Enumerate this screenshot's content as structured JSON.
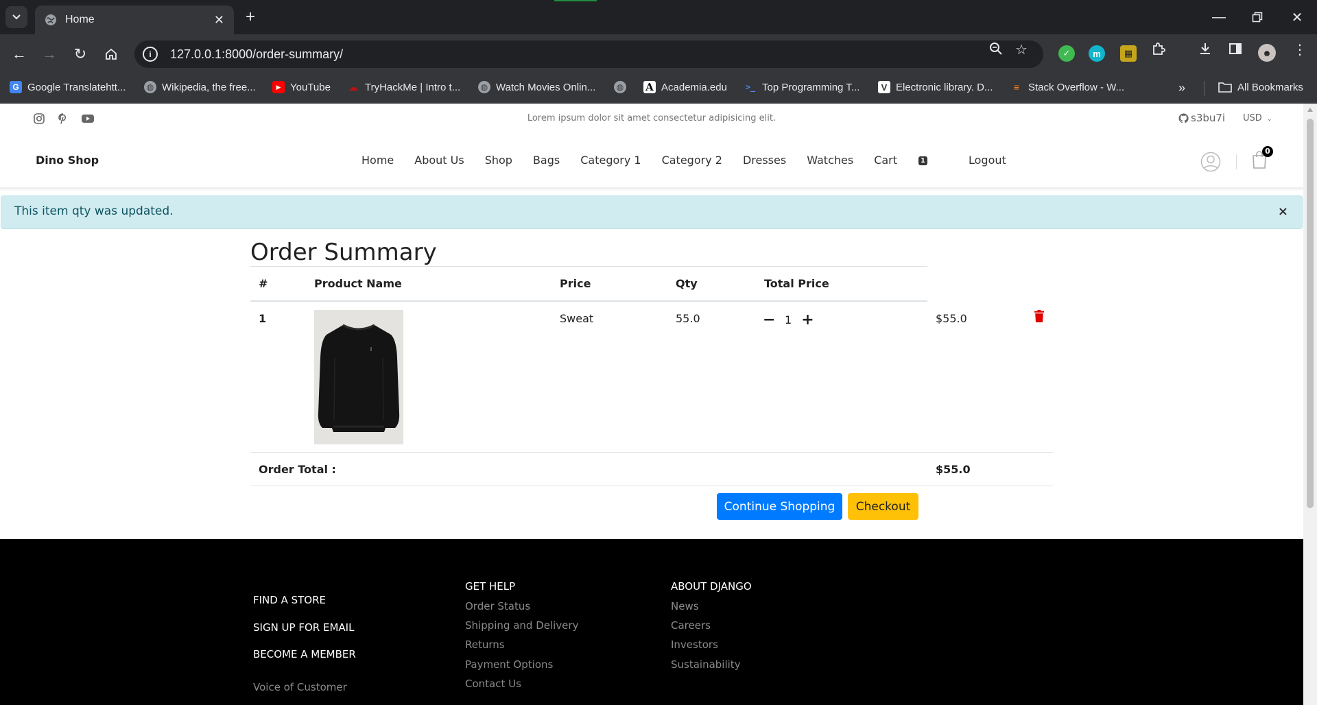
{
  "browser": {
    "tab_title": "Home",
    "url": "127.0.0.1:8000/order-summary/",
    "bookmarks": [
      {
        "label": "Google Translatehtt...",
        "icon": "google-translate-icon"
      },
      {
        "label": "Wikipedia, the free...",
        "icon": "globe-icon"
      },
      {
        "label": "YouTube",
        "icon": "youtube-icon"
      },
      {
        "label": "TryHackMe | Intro t...",
        "icon": "tryhackme-icon"
      },
      {
        "label": "Watch Movies Onlin...",
        "icon": "globe-icon"
      },
      {
        "label": "",
        "icon": "globe-icon"
      },
      {
        "label": "Academia.edu",
        "icon": "academia-icon"
      },
      {
        "label": "Top Programming T...",
        "icon": "terminal-icon"
      },
      {
        "label": "Electronic library. D...",
        "icon": "library-icon"
      },
      {
        "label": "Stack Overflow - W...",
        "icon": "stackoverflow-icon"
      }
    ],
    "all_bookmarks": "All Bookmarks"
  },
  "topbar": {
    "tagline": "Lorem ipsum dolor sit amet consectetur adipisicing elit.",
    "github_user": "s3bu7i",
    "currency": "USD"
  },
  "nav": {
    "brand": "Dino Shop",
    "items": [
      "Home",
      "About Us",
      "Shop",
      "Bags",
      "Category 1",
      "Category 2",
      "Dresses",
      "Watches",
      "Cart",
      "Logout"
    ],
    "cart_count": "1",
    "bag_count": "0"
  },
  "alert": {
    "message": "This item qty was updated.",
    "close": "×"
  },
  "order": {
    "title": "Order Summary",
    "headers": {
      "num": "#",
      "name": "Product Name",
      "price": "Price",
      "qty": "Qty",
      "total": "Total Price"
    },
    "items": [
      {
        "num": "1",
        "name": "Sweat",
        "price": "55.0",
        "qty": "1",
        "total": "$55.0"
      }
    ],
    "order_total_label": "Order Total :",
    "order_total_value": "$55.0",
    "continue_label": "Continue Shopping",
    "checkout_label": "Checkout"
  },
  "footer": {
    "big_links": [
      "FIND A STORE",
      "SIGN UP FOR EMAIL",
      "BECOME A MEMBER",
      "Voice of Customer"
    ],
    "help_title": "GET HELP",
    "help_links": [
      "Order Status",
      "Shipping and Delivery",
      "Returns",
      "Payment Options",
      "Contact Us"
    ],
    "about_title": "ABOUT DJANGO",
    "about_links": [
      "News",
      "Careers",
      "Investors",
      "Sustainability"
    ]
  },
  "colors": {
    "alert_bg": "#d1ecf1",
    "primary": "#007bff",
    "warning": "#ffc107",
    "trash": "#e00000"
  }
}
